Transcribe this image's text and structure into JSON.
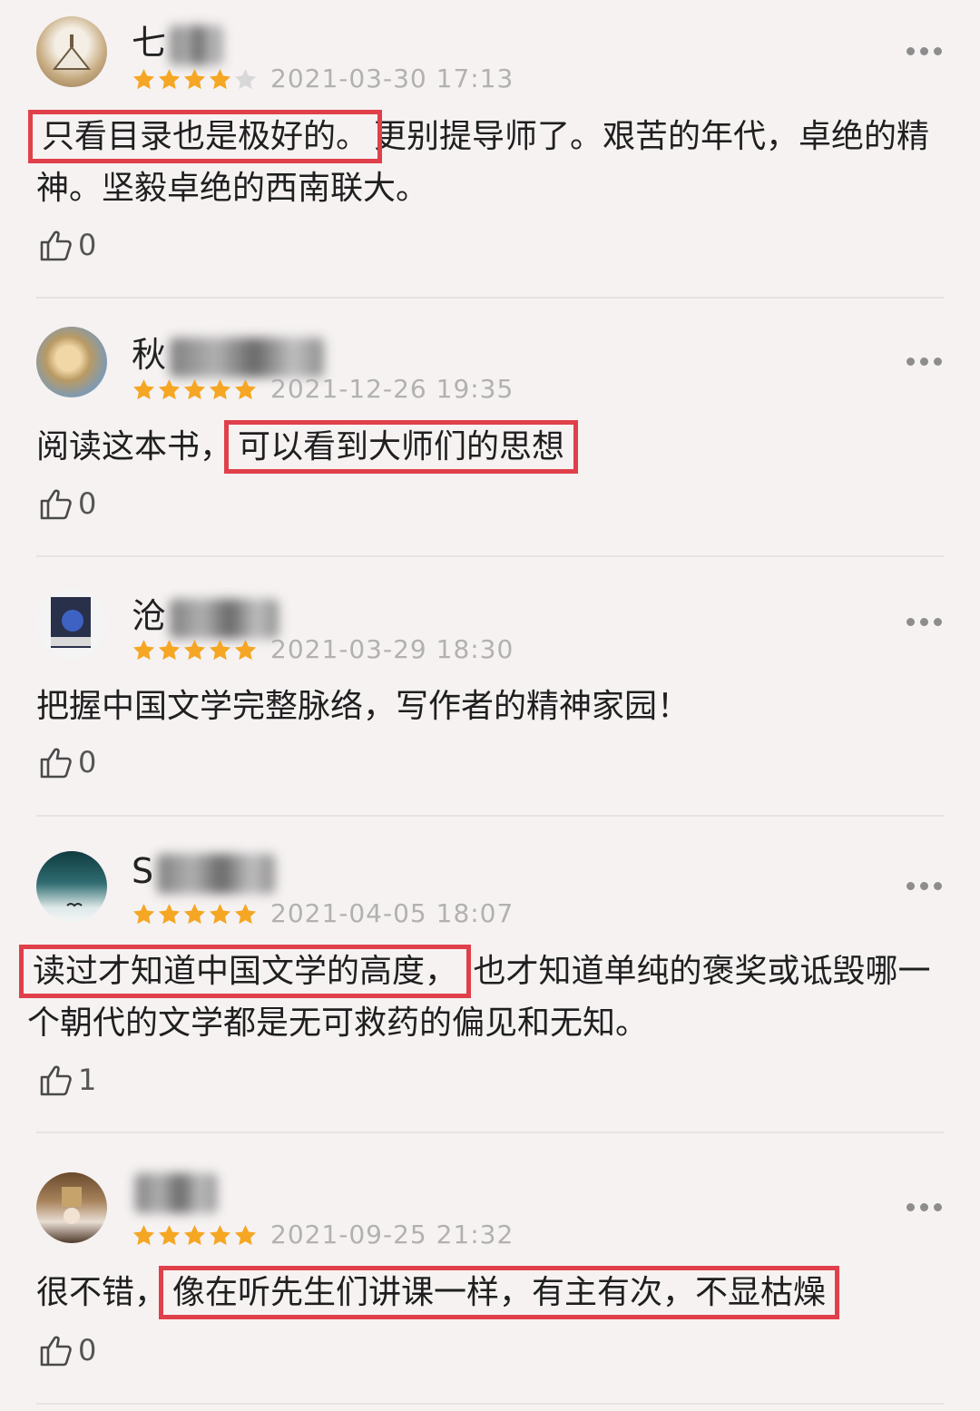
{
  "reviews": [
    {
      "user_name": "七",
      "rating": 4,
      "date": "2021-03-30 17:13",
      "text_highlight": "只看目录也是极好的。",
      "text_rest": "更别提导师了。艰苦的年代，卓绝的精神。坚毅卓绝的西南联大。",
      "likes": "0"
    },
    {
      "user_name": "秋",
      "rating": 5,
      "date": "2021-12-26 19:35",
      "text_before": "阅读这本书，",
      "text_highlight": "可以看到大师们的思想",
      "likes": "0"
    },
    {
      "user_name": "沧",
      "rating": 5,
      "date": "2021-03-29 18:30",
      "text": "把握中国文学完整脉络，写作者的精神家园！",
      "likes": "0"
    },
    {
      "user_name": "S",
      "rating": 5,
      "date": "2021-04-05 18:07",
      "text_highlight": "读过才知道中国文学的高度，",
      "text_rest": "也才知道单纯的褒奖或诋毁哪一个朝代的文学都是无可救药的偏见和无知。",
      "likes": "1"
    },
    {
      "user_name": "",
      "rating": 5,
      "date": "2021-09-25 21:32",
      "text_before": "很不错，",
      "text_highlight": "像在听先生们讲课一样，有主有次，不显枯燥",
      "likes": "0"
    }
  ],
  "colors": {
    "star": "#f5a623",
    "star_empty": "#d8d8d8",
    "highlight_box": "#e0404a",
    "date": "#b1b1b1"
  },
  "icons": {
    "like": "thumbs-up-icon",
    "more": "more-dots-icon"
  }
}
